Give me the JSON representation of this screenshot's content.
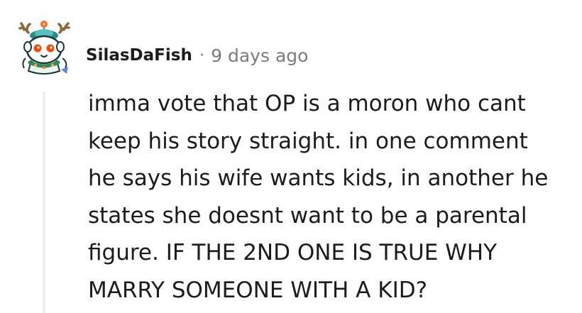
{
  "comment": {
    "author": "SilasDaFish",
    "separator": "·",
    "timestamp": "9 days ago",
    "avatar_icon": "snoo-deer-antlers-avatar-icon",
    "body_lines": [
      "imma vote that OP is a moron who cant",
      "keep his story straight. in one comment",
      "he says his wife wants kids, in another he",
      "states she doesnt want to be a parental",
      "figure. IF THE 2ND ONE IS TRUE WHY",
      "MARRY SOMEONE WITH A KID?"
    ]
  },
  "colors": {
    "text": "#1c1c1c",
    "meta": "#7c7c7c",
    "thread_line": "#edeff1"
  }
}
